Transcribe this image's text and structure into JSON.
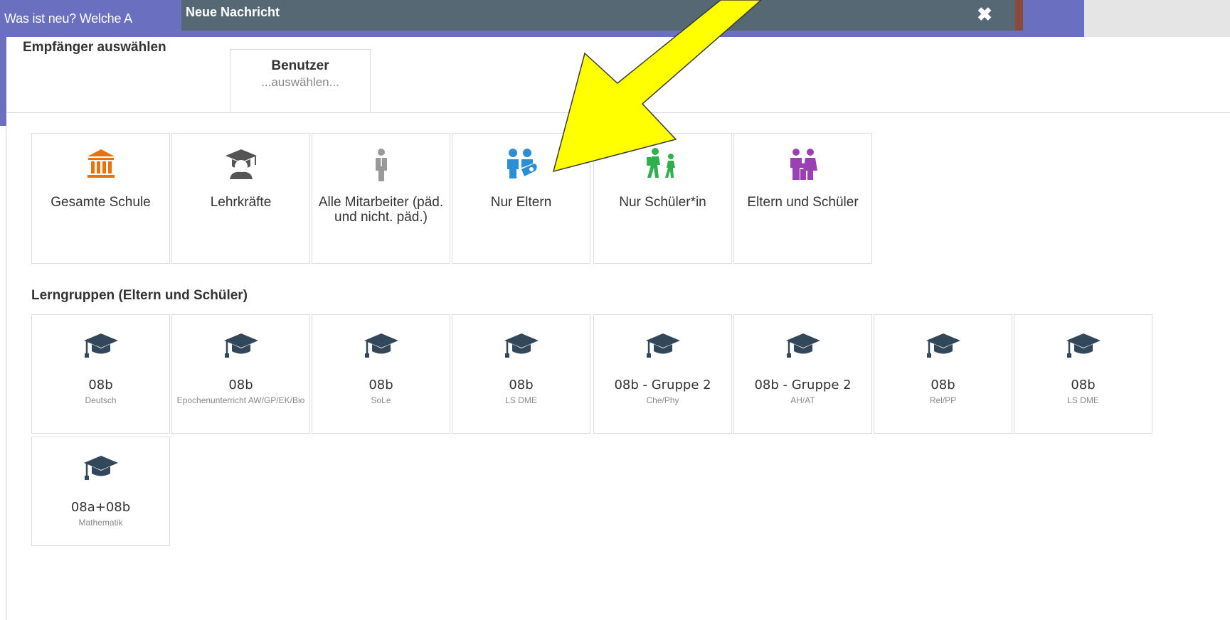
{
  "background": {
    "topbar_text": "Was ist neu? Welche A",
    "colors": {
      "topbar": "#6a6fbf"
    }
  },
  "modal": {
    "title": "Neue Nachricht",
    "close_glyph": "✖",
    "colors": {
      "header": "#566873"
    }
  },
  "tabs": {
    "static_label": "Empfänger auswählen",
    "active_tab": {
      "title": "Benutzer",
      "subtitle": "...auswählen..."
    }
  },
  "recipient_groups": [
    {
      "label": "Gesamte Schule",
      "icon": "school-building-icon",
      "color": "#e8730c"
    },
    {
      "label": "Lehrkräfte",
      "icon": "teacher-icon",
      "color": "#555555"
    },
    {
      "label": "Alle Mitarbeiter (päd. und nicht. päd.)",
      "icon": "staff-icon",
      "color": "#999999"
    },
    {
      "label": "Nur Eltern",
      "icon": "parents-icon",
      "color": "#2b8fd6"
    },
    {
      "label": "Nur Schüler*in",
      "icon": "students-walking-icon",
      "color": "#2eb04e"
    },
    {
      "label": "Eltern und Schüler",
      "icon": "family-icon",
      "color": "#9b3fb5"
    }
  ],
  "learning_groups_heading": "Lerngruppen (Eltern und Schüler)",
  "learning_groups": [
    {
      "name": "08b",
      "subject": "Deutsch"
    },
    {
      "name": "08b",
      "subject": "Epochenunterricht AW/GP/EK/Bio"
    },
    {
      "name": "08b",
      "subject": "SoLe"
    },
    {
      "name": "08b",
      "subject": "LS DME"
    },
    {
      "name": "08b - Gruppe 2",
      "subject": "Che/Phy"
    },
    {
      "name": "08b - Gruppe 2",
      "subject": "AH/AT"
    },
    {
      "name": "08b",
      "subject": "Rel/PP"
    },
    {
      "name": "08b",
      "subject": "LS DME"
    },
    {
      "name": "08a+08b",
      "subject": "Mathematik"
    }
  ],
  "annotation": {
    "arrow_color": "#ffff00",
    "points_to": "Nur Eltern"
  }
}
